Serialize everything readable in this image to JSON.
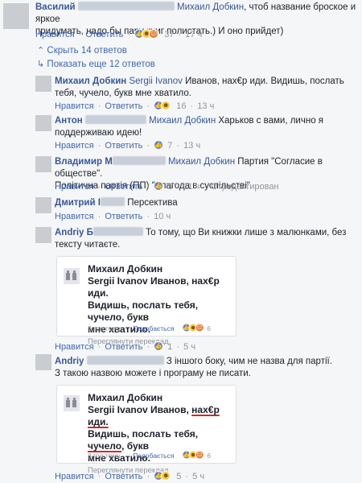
{
  "comments": {
    "vasily": {
      "name": "Василий",
      "mention": "Михаил Добкин",
      "text_1": ", чтоб название броское и яркое",
      "text_2": "придумать, надо бы пару книг полистать.) И оно прийдет)",
      "like": "Нравится",
      "reply": "Ответить",
      "reactions": "37",
      "time": "17 ч"
    },
    "hide_replies": "Скрыть 14 ответов",
    "show_more": "Показать еще 12 ответов",
    "dobkin": {
      "name": "Михаил Добкин",
      "mention": "Sergii Ivanov",
      "text_1": " Иванов, нах€р иди. Видишь, послать",
      "text_2": "тебя, чучело, букв мне хватило.",
      "like": "Нравится",
      "reply": "Ответить",
      "reactions": "16",
      "time": "13 ч"
    },
    "anton": {
      "name": "Антон",
      "mention": "Михаил Добкин",
      "text_1": " Харьков с вами, лично я",
      "text_2": "поддерживаю идею!",
      "like": "Нравится",
      "reply": "Ответить",
      "reactions": "7",
      "time": "13 ч"
    },
    "vladimir": {
      "name": "Владимир",
      "name_suffix": "М",
      "mention": "Михаил Добкин",
      "text_1": " Партия \"Согласие в обществе\".",
      "text_2": "Політична партія (ПП) \"Злагода в суспільстві\"",
      "like": "Нравится",
      "reply": "Ответить",
      "reactions": "5",
      "time": "11 ч",
      "edited": "Отредактирован"
    },
    "dmitry": {
      "name": "Дмитрий",
      "name_suffix": "І",
      "text": "Персектива",
      "like": "Нравится",
      "reply": "Ответить",
      "time": "10 ч"
    },
    "andriy1": {
      "name": "Andriy",
      "name_suffix": "Б",
      "text_1": "То тому, що Ви книжки лише з малюнками, без",
      "text_2": "тексту читаєте.",
      "card": {
        "title": "Михаил Добкин",
        "line_1": "Sergii Ivanov Иванов, нах€р иди.",
        "line_2": "Видишь, послать тебя, чучело, букв",
        "line_3": "мне хватило.",
        "translate": "Переглянути переклад",
        "time": "8 год тому",
        "like": "Подобається",
        "reactions": "6"
      }
    },
    "andriy2": {
      "name": "Andriy",
      "text_1": "З іншого боку, чим не назва для партії.",
      "text_2": "З такою назвою можете і програму не писати.",
      "like": "Нравится",
      "reply": "Ответить",
      "reactions": "1",
      "time": "5 ч",
      "card": {
        "title": "Михаил Добкин",
        "line_1a": "Sergii Ivanov Иванов, ",
        "line_1b": "нах€р иди.",
        "line_2a": "Видишь, послать тебя, ",
        "line_2b": "чучело",
        "line_2c": ", букв",
        "line_3": "мне хватило.",
        "translate": "Переглянути переклад",
        "time": "8 год тому",
        "like": "Подобається",
        "reactions": "6"
      },
      "bottom_like": "Нравится",
      "bottom_reply": "Ответить",
      "bottom_reactions": "5",
      "bottom_time": "5 ч"
    },
    "sep": "·"
  },
  "colors": {
    "link": "#385898",
    "accent": "#4267b2",
    "meta_gray": "#90949c",
    "underline": "#d9252a"
  }
}
